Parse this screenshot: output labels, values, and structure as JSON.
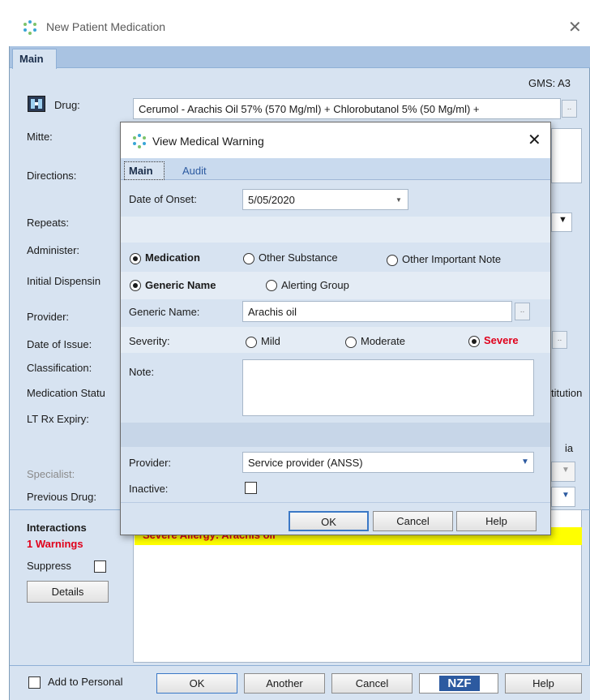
{
  "window": {
    "title": "New Patient Medication",
    "close_glyph": "✕",
    "tab_main": "Main",
    "gms": "GMS: A3"
  },
  "form": {
    "drug_label": "Drug:",
    "drug_value": "Cerumol - Arachis Oil 57% (570 Mg/ml) + Chlorobutanol 5% (50 Mg/ml) +",
    "mitte_label": "Mitte:",
    "directions_label": "Directions:",
    "repeats_label": "Repeats:",
    "administer_label": "Administer:",
    "initial_dispensing_label": "Initial Dispensin",
    "provider_label": "Provider:",
    "date_of_issue_label": "Date of Issue:",
    "classification_label": "Classification:",
    "medication_status_label": "Medication Statu",
    "lt_rx_expiry_label": "LT Rx Expiry:",
    "specialist_label": "Specialist:",
    "previous_drug_label": "Previous Drug:",
    "right_cut_1": "titution",
    "right_cut_2": "ia"
  },
  "interactions": {
    "title": "Interactions",
    "warnings": "1 Warnings",
    "suppress_label": "Suppress",
    "details_button": "Details",
    "alert_text": "Severe Allergy: Arachis oil"
  },
  "footer": {
    "add_to_personal": "Add to Personal",
    "ok": "OK",
    "another": "Another",
    "cancel": "Cancel",
    "nzf": "NZF",
    "help": "Help"
  },
  "dialog": {
    "title": "View Medical Warning",
    "close_glyph": "✕",
    "tabs": [
      "Main",
      "Audit"
    ],
    "date_of_onset_label": "Date of Onset:",
    "date_of_onset_value": "5/05/2020",
    "type_options": [
      "Medication",
      "Other Substance",
      "Other Important Note"
    ],
    "type_selected": "Medication",
    "name_options": [
      "Generic Name",
      "Alerting Group"
    ],
    "name_selected": "Generic Name",
    "generic_name_label": "Generic Name:",
    "generic_name_value": "Arachis oil",
    "ellipsis": "..",
    "severity_label": "Severity:",
    "severity_options": [
      "Mild",
      "Moderate",
      "Severe"
    ],
    "severity_selected": "Severe",
    "note_label": "Note:",
    "note_value": "",
    "provider_label": "Provider:",
    "provider_value": "Service provider (ANSS)",
    "inactive_label": "Inactive:",
    "inactive_checked": false,
    "ok": "OK",
    "cancel": "Cancel",
    "help": "Help"
  },
  "colors": {
    "severe_red": "#e0001b",
    "alert_yellow": "#ffff00",
    "window_bg": "#d7e3f1",
    "nzf_blue": "#2c5aa0"
  },
  "icons": {
    "app": "gear-cluster-icon",
    "drug": "drug-lookup-icon",
    "dropdown": "chevron-down-icon"
  }
}
